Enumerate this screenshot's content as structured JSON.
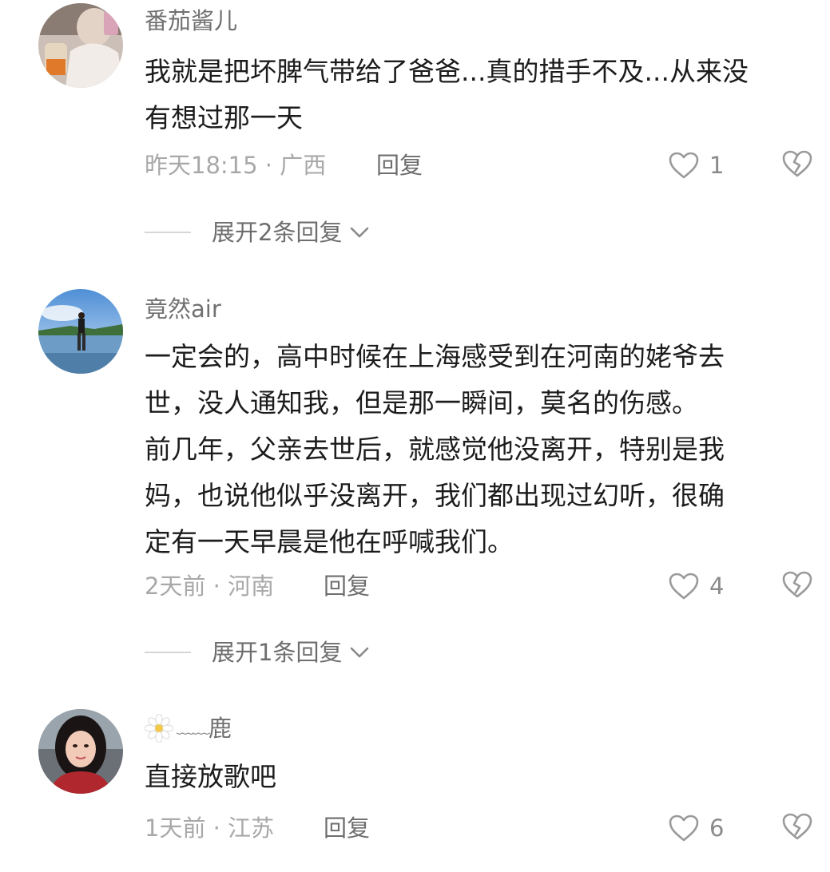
{
  "comments": [
    {
      "username": "番茄酱儿",
      "text_lines": [
        "我就是把坏脾气带给了爸爸...真的措手不及...从来没",
        "有想过那一天"
      ],
      "meta": "昨天18:15 · 广西",
      "reply_label": "回复",
      "like_count": "1",
      "expand_label": "展开2条回复"
    },
    {
      "username": "竟然air",
      "text_lines": [
        "一定会的，高中时候在上海感受到在河南的姥爷去",
        "世，没人通知我，但是那一瞬间，莫名的伤感。",
        "前几年，父亲去世后，就感觉他没离开，特别是我",
        "妈，也说他似乎没离开，我们都出现过幻听，很确",
        "定有一天早晨是他在呼喊我们。"
      ],
      "meta": "2天前 · 河南",
      "reply_label": "回复",
      "like_count": "4",
      "expand_label": "展开1条回复"
    },
    {
      "username_decor": "﹏﹏",
      "username_text": "鹿",
      "text_lines": [
        "直接放歌吧"
      ],
      "meta": "1天前 · 江苏",
      "reply_label": "回复",
      "like_count": "6"
    }
  ],
  "icons": {
    "like": "heart-outline-icon",
    "dislike": "broken-heart-icon",
    "expand": "chevron-down-icon",
    "username_prefix": "daisy-icon"
  },
  "colors": {
    "username": "#707070",
    "text": "#1c1c1c",
    "meta": "#a8a8a8",
    "action": "#6e6e6e",
    "icon": "#9a9a9a"
  }
}
